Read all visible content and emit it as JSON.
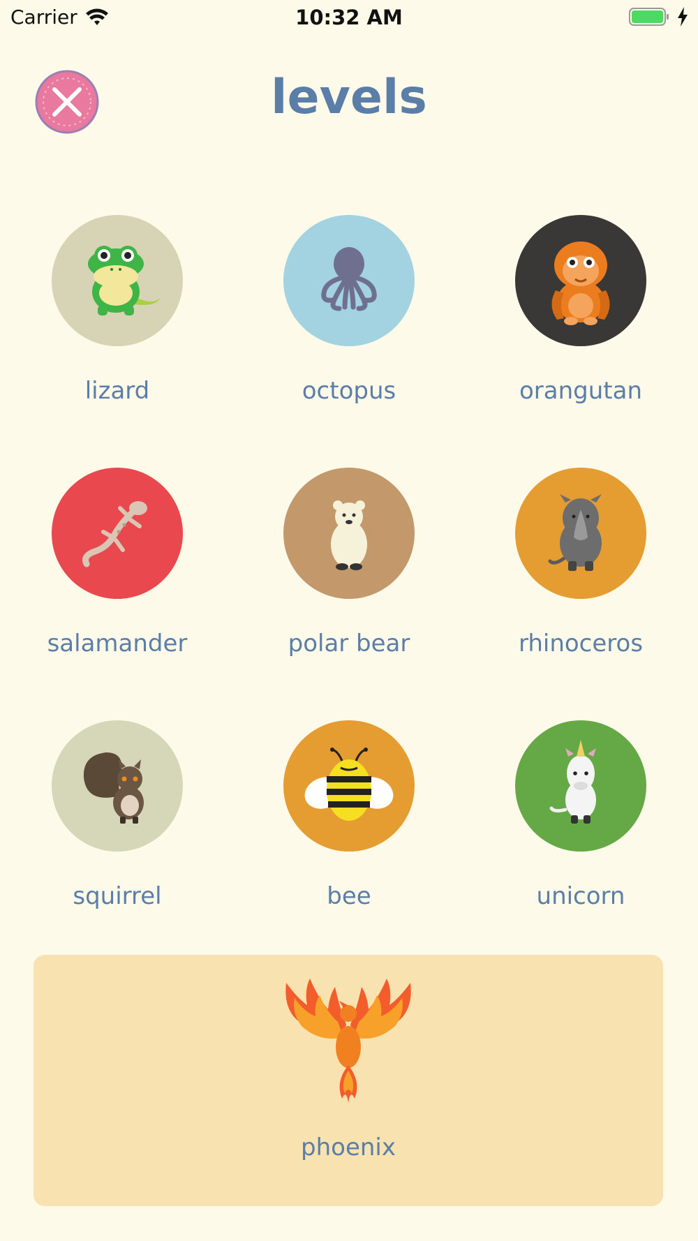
{
  "status_bar": {
    "carrier": "Carrier",
    "time": "10:32 AM"
  },
  "header": {
    "title": "levels"
  },
  "colors": {
    "background": "#fefae9",
    "text": "#5a7ea8",
    "close_button": "#e9799e",
    "special_card": "#f8e3b0"
  },
  "levels": [
    {
      "label": "lizard",
      "circle_color": "#d7d4b6",
      "icon": "frog-icon"
    },
    {
      "label": "octopus",
      "circle_color": "#a3d3e0",
      "icon": "octopus-icon"
    },
    {
      "label": "orangutan",
      "circle_color": "#393837",
      "icon": "orangutan-icon"
    },
    {
      "label": "salamander",
      "circle_color": "#e8484e",
      "icon": "gecko-icon"
    },
    {
      "label": "polar bear",
      "circle_color": "#c3986b",
      "icon": "polar-bear-icon"
    },
    {
      "label": "rhinoceros",
      "circle_color": "#e59d31",
      "icon": "rhino-icon"
    },
    {
      "label": "squirrel",
      "circle_color": "#d6d6b8",
      "icon": "squirrel-icon"
    },
    {
      "label": "bee",
      "circle_color": "#e59d31",
      "icon": "bee-icon"
    },
    {
      "label": "unicorn",
      "circle_color": "#65a947",
      "icon": "unicorn-icon"
    }
  ],
  "special": {
    "label": "phoenix",
    "icon": "phoenix-icon"
  }
}
